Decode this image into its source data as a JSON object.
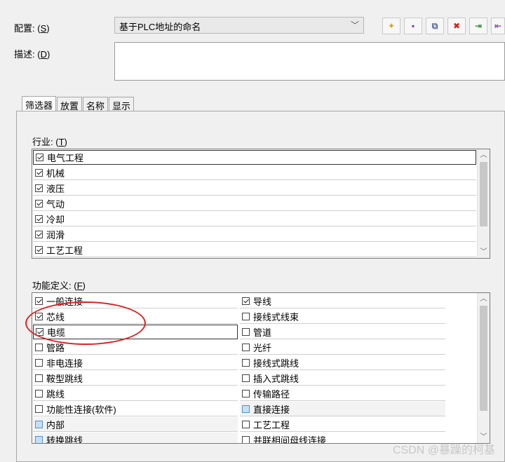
{
  "config": {
    "label": "配置:",
    "mnemonic": "S",
    "value": "基于PLC地址的命名"
  },
  "description": {
    "label": "描述:",
    "mnemonic": "D",
    "value": ""
  },
  "toolbar": {
    "icons": [
      "new-icon",
      "save-icon",
      "copy-icon",
      "delete-icon",
      "import-icon",
      "export-icon"
    ],
    "glyphs": [
      "✦",
      "▪",
      "⧉",
      "✖",
      "⇥",
      "⇤"
    ],
    "colors": [
      "#e8a000",
      "#7a3aa0",
      "#5a6a9a",
      "#d42020",
      "#2e8b2e",
      "#8a4ab0"
    ]
  },
  "tabs": [
    {
      "label": "筛选器",
      "active": true
    },
    {
      "label": "放置",
      "active": false
    },
    {
      "label": "名称",
      "active": false
    },
    {
      "label": "显示",
      "active": false
    }
  ],
  "industry": {
    "label": "行业:",
    "mnemonic": "T",
    "items": [
      {
        "label": "电气工程",
        "checked": true
      },
      {
        "label": "机械",
        "checked": true
      },
      {
        "label": "液压",
        "checked": true
      },
      {
        "label": "气动",
        "checked": true
      },
      {
        "label": "冷却",
        "checked": true
      },
      {
        "label": "润滑",
        "checked": true
      },
      {
        "label": "工艺工程",
        "checked": true
      }
    ]
  },
  "function": {
    "label": "功能定义:",
    "mnemonic": "F",
    "left": [
      {
        "label": "一般连接",
        "state": "checked"
      },
      {
        "label": "芯线",
        "state": "checked"
      },
      {
        "label": "电缆",
        "state": "checked"
      },
      {
        "label": "管路",
        "state": "unchecked"
      },
      {
        "label": "非电连接",
        "state": "unchecked"
      },
      {
        "label": "鞍型跳线",
        "state": "unchecked"
      },
      {
        "label": "跳线",
        "state": "unchecked"
      },
      {
        "label": "功能性连接(软件)",
        "state": "unchecked"
      },
      {
        "label": "内部",
        "state": "blue"
      },
      {
        "label": "转换跳线",
        "state": "blue"
      }
    ],
    "right": [
      {
        "label": "导线",
        "state": "checked"
      },
      {
        "label": "接线式线束",
        "state": "unchecked"
      },
      {
        "label": "管道",
        "state": "unchecked"
      },
      {
        "label": "光纤",
        "state": "unchecked"
      },
      {
        "label": "接线式跳线",
        "state": "unchecked"
      },
      {
        "label": "插入式跳线",
        "state": "unchecked"
      },
      {
        "label": "传输路径",
        "state": "unchecked"
      },
      {
        "label": "直接连接",
        "state": "blue"
      },
      {
        "label": "工艺工程",
        "state": "unchecked"
      },
      {
        "label": "并联相间母线连接",
        "state": "unchecked"
      }
    ]
  },
  "watermark": "CSDN @暴躁的柯基"
}
